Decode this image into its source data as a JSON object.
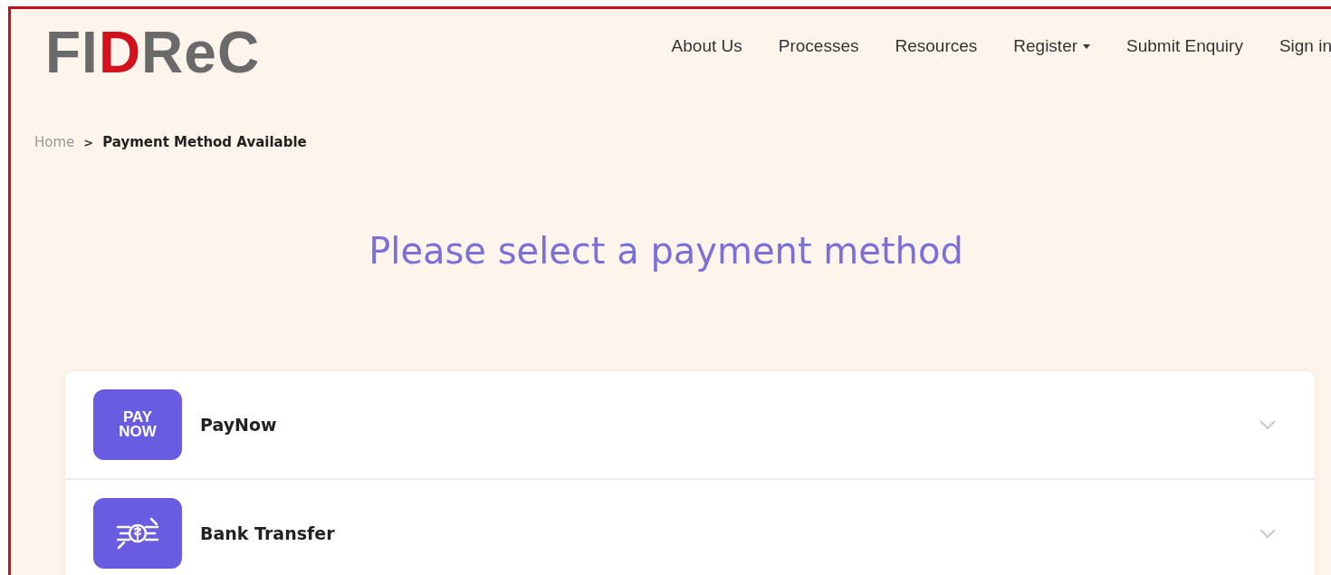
{
  "logo": {
    "parts": [
      {
        "text": "FI",
        "kind": "plain"
      },
      {
        "text": "D",
        "kind": "accent"
      },
      {
        "text": "ReC",
        "kind": "plain"
      }
    ]
  },
  "nav": [
    {
      "label": "About Us",
      "kind": "link"
    },
    {
      "label": "Processes",
      "kind": "link"
    },
    {
      "label": "Resources",
      "kind": "link"
    },
    {
      "label": "Register",
      "kind": "dropdown"
    },
    {
      "label": "Submit Enquiry",
      "kind": "link"
    },
    {
      "label": "Sign in",
      "kind": "link"
    }
  ],
  "breadcrumb": {
    "home": "Home",
    "separator": ">",
    "current": "Payment Method Available"
  },
  "heading": "Please select a payment method",
  "methods": [
    {
      "label": "PayNow",
      "kind": "paynow",
      "badge": [
        "PAY",
        "NOW"
      ],
      "expanded": false
    },
    {
      "label": "Bank Transfer",
      "kind": "bank",
      "expanded": false
    }
  ]
}
